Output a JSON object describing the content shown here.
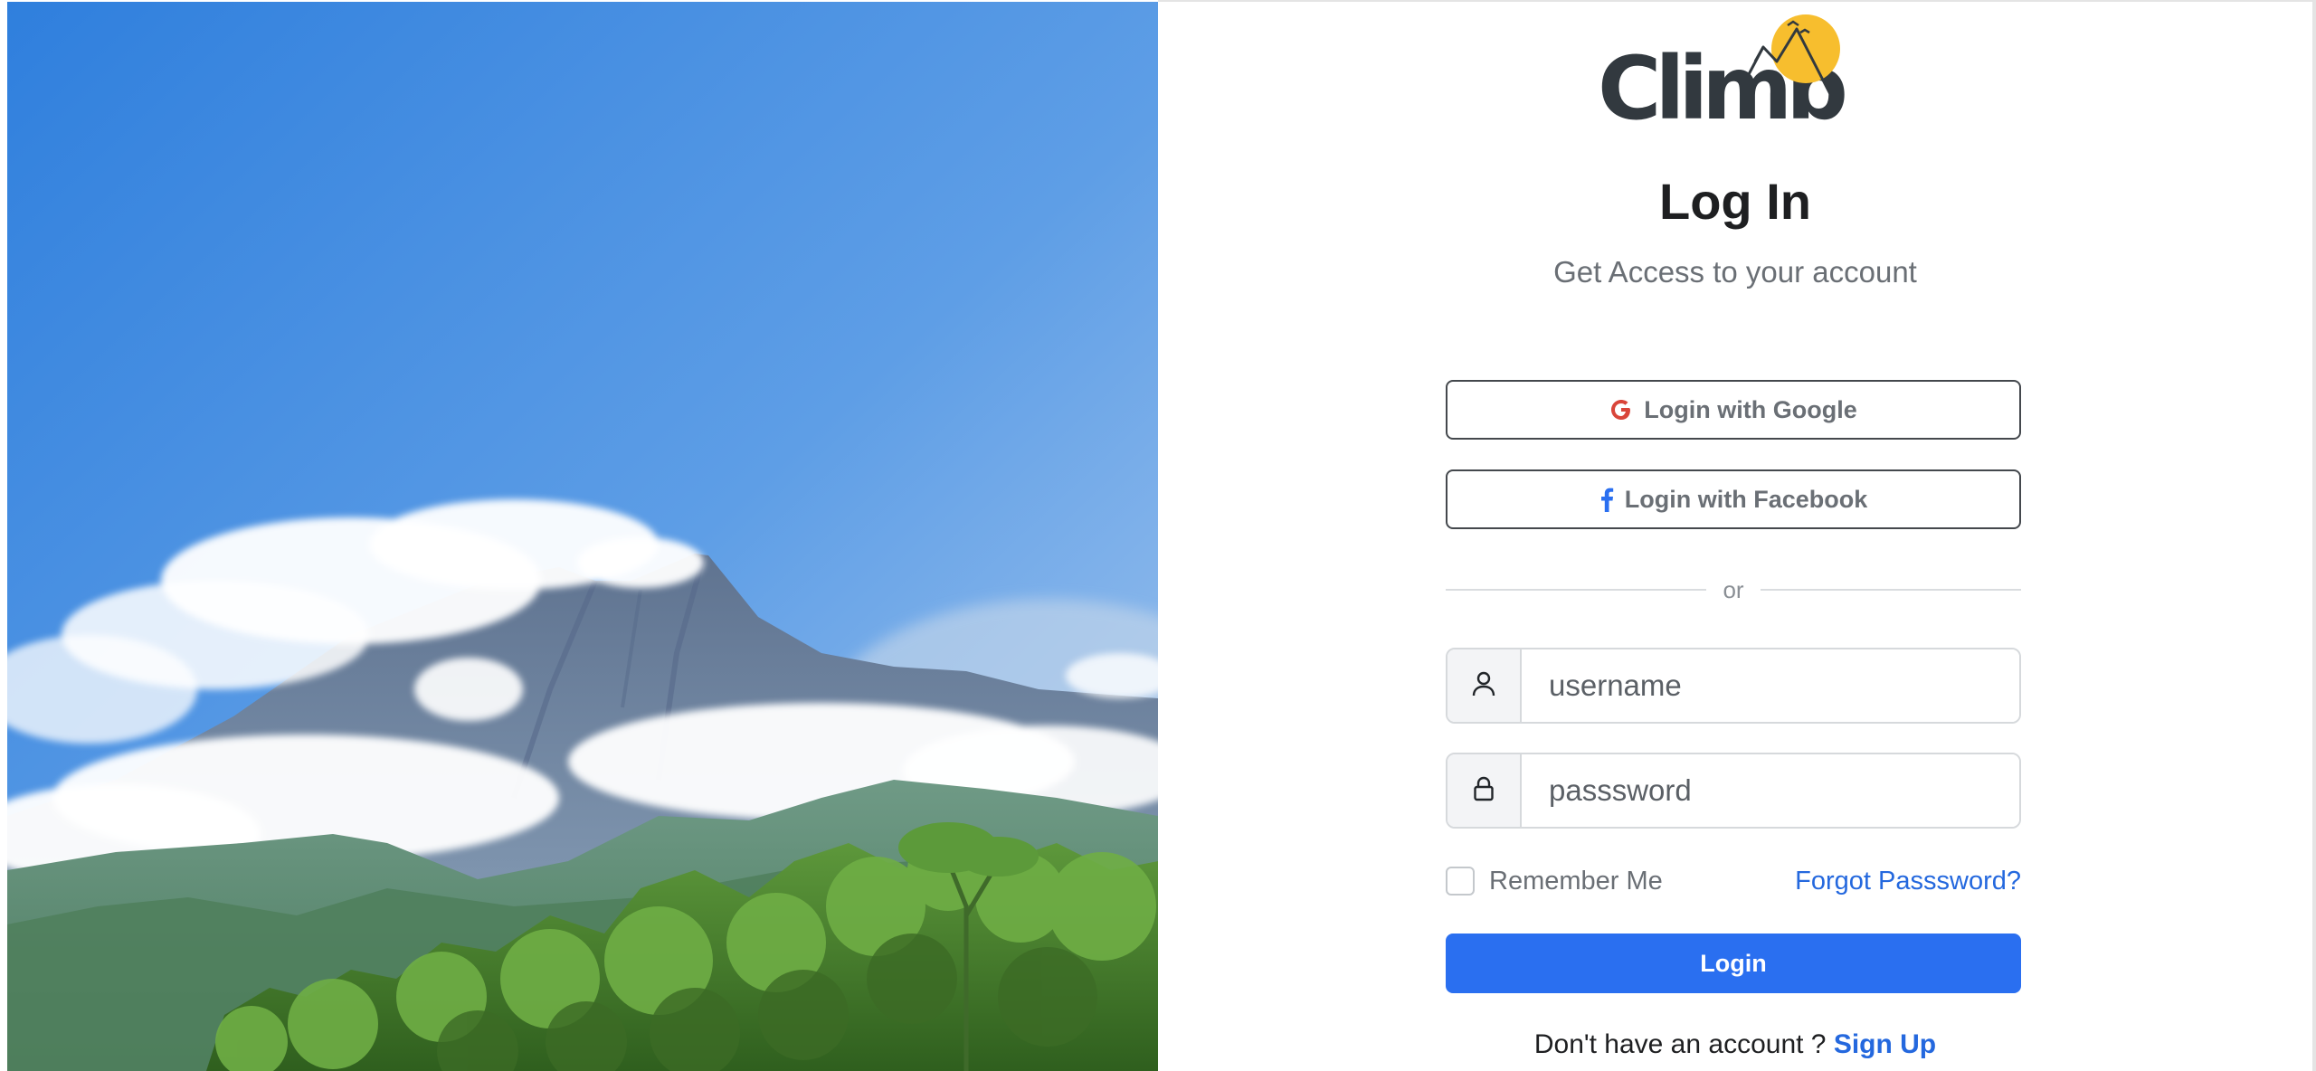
{
  "brand": {
    "name": "Climb",
    "text_color": "#32393f",
    "sun_color": "#f7be2e"
  },
  "login": {
    "title": "Log In",
    "subtitle": "Get Access to your account"
  },
  "social": {
    "google_label": "Login with Google",
    "google_icon": "google-icon",
    "google_color": "#d9453a",
    "facebook_label": "Login with Facebook",
    "facebook_icon": "facebook-icon",
    "facebook_color": "#2a6ff0"
  },
  "divider": {
    "text": "or"
  },
  "form": {
    "username_placeholder": "username",
    "username_icon": "user-icon",
    "password_placeholder": "passsword",
    "password_icon": "lock-icon",
    "remember_label": "Remember Me",
    "remember_checked": false,
    "forgot_label": "Forgot Passsword?",
    "submit_label": "Login",
    "accent_color": "#2a6ff0"
  },
  "signup": {
    "prompt": "Don't have an account ? ",
    "link_label": "Sign Up"
  },
  "hero": {
    "icon": "mountain-landscape-image"
  }
}
